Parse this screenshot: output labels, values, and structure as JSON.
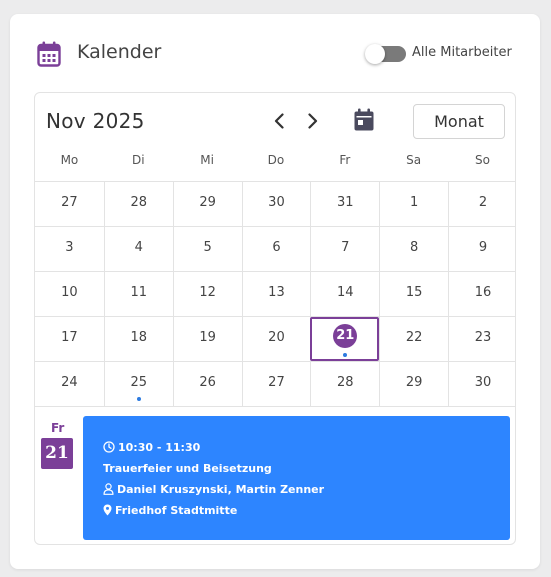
{
  "header": {
    "title": "Kalender",
    "icon": "calendar-icon",
    "toggle_label": "Alle Mitarbeiter",
    "toggle_on": false
  },
  "toolbar": {
    "month_title": "Nov 2025",
    "prev_icon": "chevron-left-icon",
    "next_icon": "chevron-right-icon",
    "today_icon": "calendar-today-icon",
    "view_label": "Monat"
  },
  "weekdays": [
    "Mo",
    "Di",
    "Mi",
    "Do",
    "Fr",
    "Sa",
    "So"
  ],
  "weeks": [
    [
      "27",
      "28",
      "29",
      "30",
      "31",
      "1",
      "2"
    ],
    [
      "3",
      "4",
      "5",
      "6",
      "7",
      "8",
      "9"
    ],
    [
      "10",
      "11",
      "12",
      "13",
      "14",
      "15",
      "16"
    ],
    [
      "17",
      "18",
      "19",
      "20",
      "21",
      "22",
      "23"
    ],
    [
      "24",
      "25",
      "26",
      "27",
      "28",
      "29",
      "30"
    ]
  ],
  "selected_day": "21",
  "event_days": [
    "21",
    "25"
  ],
  "event_panel": {
    "weekday": "Fr",
    "date": "21",
    "event": {
      "time": "10:30 - 11:30",
      "title": "Trauerfeier und Beisetzung",
      "people": "Daniel Kruszynski, Martin Zenner",
      "location": "Friedhof Stadtmitte"
    }
  },
  "colors": {
    "accent": "#7b3f98",
    "event": "#2d85ff",
    "dot": "#2d7be0"
  }
}
